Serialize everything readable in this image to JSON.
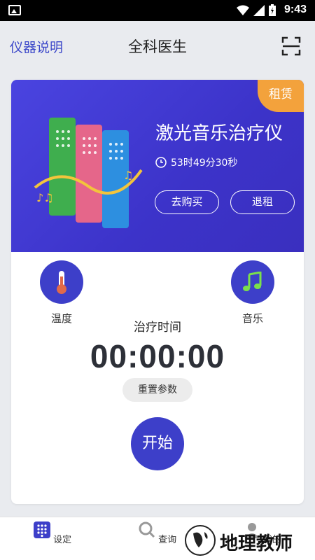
{
  "status_bar": {
    "time": "9:43"
  },
  "header": {
    "manual_label": "仪器说明",
    "title": "全科医生"
  },
  "device": {
    "rent_tag": "租赁",
    "name": "激光音乐治疗仪",
    "remaining_time": "53时49分30秒",
    "buy_label": "去购买",
    "return_label": "退租"
  },
  "controls": {
    "temperature_label": "温度",
    "music_label": "音乐",
    "timer_title": "治疗时间",
    "timer_value": "00:00:00",
    "reset_label": "重置参数",
    "start_label": "开始"
  },
  "nav": {
    "items": [
      {
        "label": "设定"
      },
      {
        "label": "查询"
      },
      {
        "label": "我的"
      }
    ]
  },
  "watermark": {
    "text": "地理教师"
  },
  "colors": {
    "primary": "#3d3fc9",
    "accent": "#f3a23c",
    "manual_link": "#3b47c9",
    "music_note": "#7be04a",
    "thermometer": "#e06a4a"
  }
}
